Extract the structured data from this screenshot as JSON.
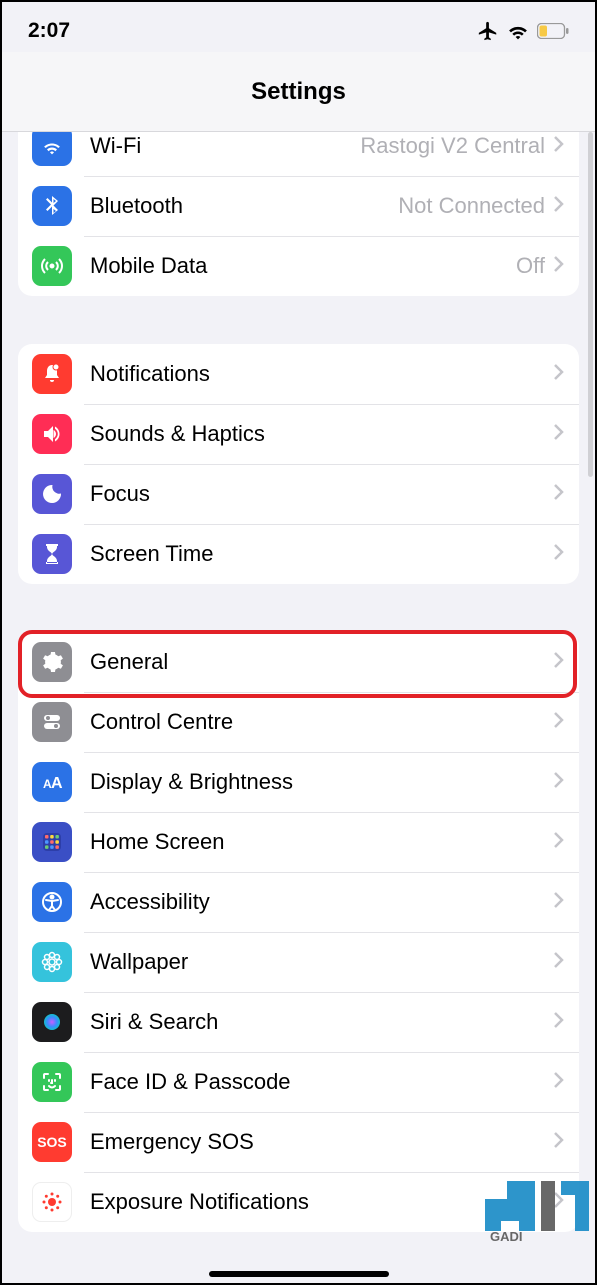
{
  "status": {
    "time": "2:07"
  },
  "header": {
    "title": "Settings"
  },
  "group1": {
    "wifi": {
      "label": "Wi-Fi",
      "value": "Rastogi V2 Central"
    },
    "bluetooth": {
      "label": "Bluetooth",
      "value": "Not Connected"
    },
    "mobile": {
      "label": "Mobile Data",
      "value": "Off"
    }
  },
  "group2": {
    "notifications": {
      "label": "Notifications"
    },
    "sounds": {
      "label": "Sounds & Haptics"
    },
    "focus": {
      "label": "Focus"
    },
    "screentime": {
      "label": "Screen Time"
    }
  },
  "group3": {
    "general": {
      "label": "General"
    },
    "control": {
      "label": "Control Centre"
    },
    "display": {
      "label": "Display & Brightness"
    },
    "homescreen": {
      "label": "Home Screen"
    },
    "accessibility": {
      "label": "Accessibility"
    },
    "wallpaper": {
      "label": "Wallpaper"
    },
    "siri": {
      "label": "Siri & Search"
    },
    "faceid": {
      "label": "Face ID & Passcode"
    },
    "sos": {
      "label": "Emergency SOS",
      "icon_text": "SOS"
    },
    "exposure": {
      "label": "Exposure Notifications"
    }
  },
  "watermark": {
    "text": "GADI"
  }
}
